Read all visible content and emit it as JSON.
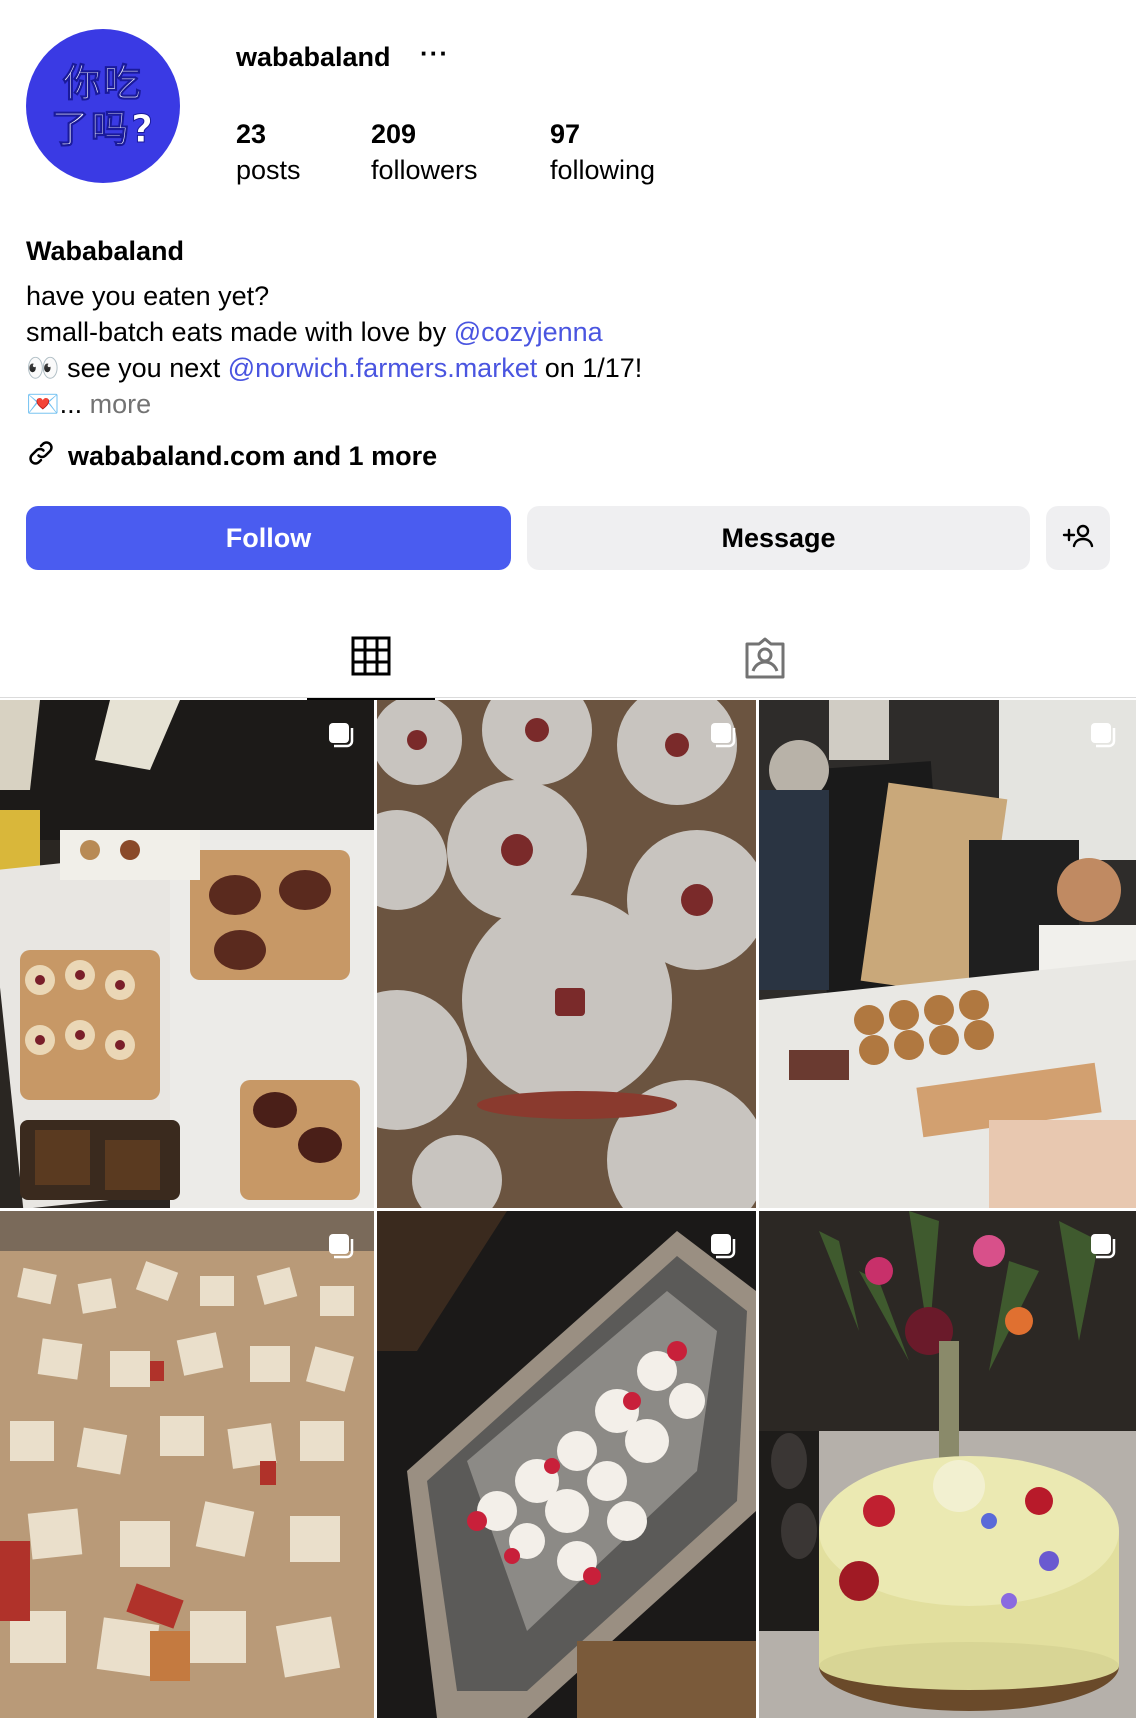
{
  "profile": {
    "avatar_line1": "你吃",
    "avatar_line2": "了吗?",
    "username": "wababaland",
    "more_options": "···",
    "stats": [
      {
        "num": "23",
        "label": "posts"
      },
      {
        "num": "209",
        "label": "followers"
      },
      {
        "num": "97",
        "label": "following"
      }
    ],
    "display_name": "Wababaland",
    "bio_line1": "have you eaten yet?",
    "bio_line2_text": "small-batch eats made with love by ",
    "bio_line2_mention": "@cozyjenna",
    "bio_line3_emoji": "👀",
    "bio_line3_text": " see you next ",
    "bio_line3_mention": "@norwich.farmers.market",
    "bio_line3_end": " on 1/17!",
    "bio_line4_emoji": "💌",
    "bio_line4_ellipsis": "... ",
    "bio_more": "more",
    "link_text": "wababaland.com and 1 more"
  },
  "actions": {
    "follow": "Follow",
    "message": "Message"
  },
  "tabs": [
    {
      "name": "posts-grid",
      "icon": "grid-icon",
      "active": true
    },
    {
      "name": "tagged",
      "icon": "tagged-user-icon",
      "active": false
    }
  ],
  "colors": {
    "accent": "#4a5cf0",
    "mention": "#4a55e0",
    "avatar_bg": "#3a3ae4",
    "secondary_button": "#efeff1"
  },
  "posts": [
    {
      "desc": "carousel-icon",
      "scene": "market-boxes"
    },
    {
      "desc": "carousel-icon",
      "scene": "linzer-cookies"
    },
    {
      "desc": "carousel-icon",
      "scene": "market-stall"
    },
    {
      "desc": "carousel-icon",
      "scene": "diced-apples"
    },
    {
      "desc": "carousel-icon",
      "scene": "sliced-radishes"
    },
    {
      "desc": "carousel-icon",
      "scene": "floral-cake"
    }
  ]
}
